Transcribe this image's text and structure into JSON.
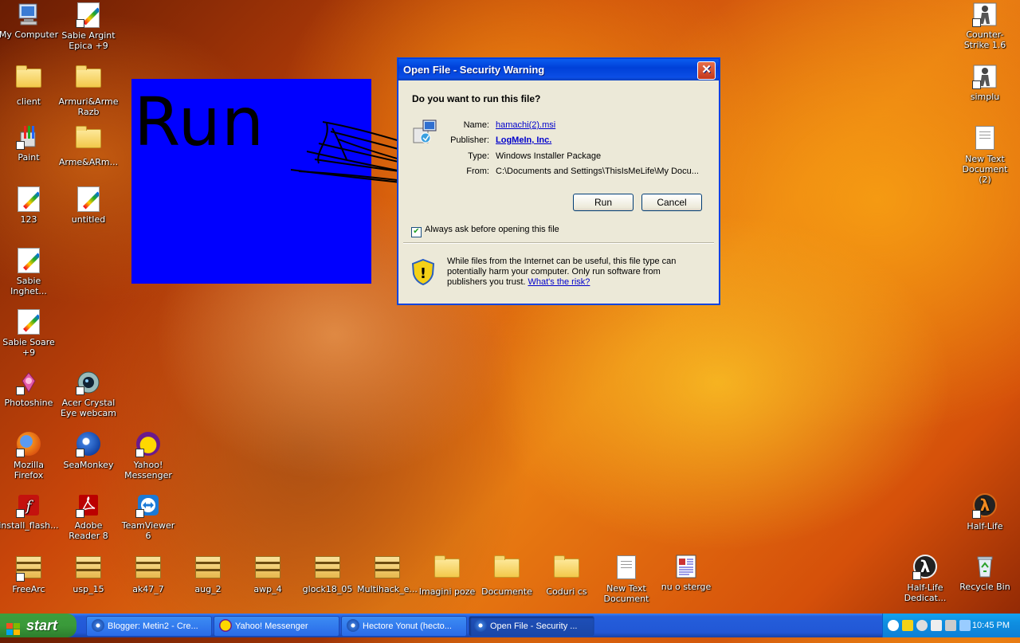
{
  "desktop": {
    "icons_left": [
      {
        "label": "My Computer",
        "type": "computer"
      },
      {
        "label": "Sabie Argint Epica +9",
        "type": "paint"
      },
      {
        "label": "client",
        "type": "folder"
      },
      {
        "label": "Armuri&Arme Razb",
        "type": "folder"
      },
      {
        "label": "Paint",
        "type": "paint"
      },
      {
        "label": "Arme&ARm...",
        "type": "folder"
      },
      {
        "label": "123",
        "type": "paint"
      },
      {
        "label": "untitled",
        "type": "paint"
      },
      {
        "label": "Sabie Inghet...",
        "type": "paint"
      },
      {
        "label": "Sabie Soare +9",
        "type": "paint"
      },
      {
        "label": "Photoshine",
        "type": "app"
      },
      {
        "label": "Acer Crystal Eye webcam",
        "type": "app"
      },
      {
        "label": "Mozilla Firefox",
        "type": "firefox"
      },
      {
        "label": "SeaMonkey",
        "type": "app"
      },
      {
        "label": "Yahoo! Messenger",
        "type": "yahoo"
      },
      {
        "label": "install_flash...",
        "type": "flash"
      },
      {
        "label": "Adobe Reader 8",
        "type": "adobe"
      },
      {
        "label": "TeamViewer 6",
        "type": "teamviewer"
      }
    ],
    "icons_right": [
      {
        "label": "Counter-Strike 1.6"
      },
      {
        "label": "simplu"
      },
      {
        "label": "New Text Document (2)"
      },
      {
        "label": "Half-Life"
      },
      {
        "label": "Recycle Bin"
      },
      {
        "label": "Half-Life Dedicat..."
      }
    ],
    "icons_bottom": [
      {
        "label": "FreeArc"
      },
      {
        "label": "usp_15"
      },
      {
        "label": "ak47_7"
      },
      {
        "label": "aug_2"
      },
      {
        "label": "awp_4"
      },
      {
        "label": "glock18_05"
      },
      {
        "label": "Multihack_e..."
      },
      {
        "label": "Imagini poze"
      },
      {
        "label": "Documente"
      },
      {
        "label": "Coduri cs"
      },
      {
        "label": "New Text Document"
      },
      {
        "label": "nu o sterge"
      }
    ],
    "overlay_text": "Run",
    "overlay_color": "#0000ff"
  },
  "dialog": {
    "title": "Open File - Security Warning",
    "close_label": "✕",
    "question": "Do you want to run this file?",
    "name_key": "Name:",
    "name_value": "hamachi(2).msi",
    "publisher_key": "Publisher:",
    "publisher_value": "LogMeIn, Inc.",
    "type_key": "Type:",
    "type_value": "Windows Installer Package",
    "from_key": "From:",
    "from_value": "C:\\Documents and Settings\\ThisIsMeLife\\My Docu...",
    "run_label": "Run",
    "cancel_label": "Cancel",
    "checkbox_label": "Always ask before opening this file",
    "checkbox_checked": true,
    "warning_text": "While files from the Internet can be useful, this file type can potentially harm your computer. Only run software from publishers you trust.",
    "warning_link": "What's the risk?"
  },
  "taskbar": {
    "start_label": "start",
    "tasks": [
      {
        "label": "Blogger: Metin2 - Cre...",
        "active": false
      },
      {
        "label": "Yahoo! Messenger",
        "active": false
      },
      {
        "label": "Hectore Yonut (hecto...",
        "active": false
      },
      {
        "label": "Open File - Security ...",
        "active": true
      }
    ],
    "clock": "10:45 PM"
  }
}
